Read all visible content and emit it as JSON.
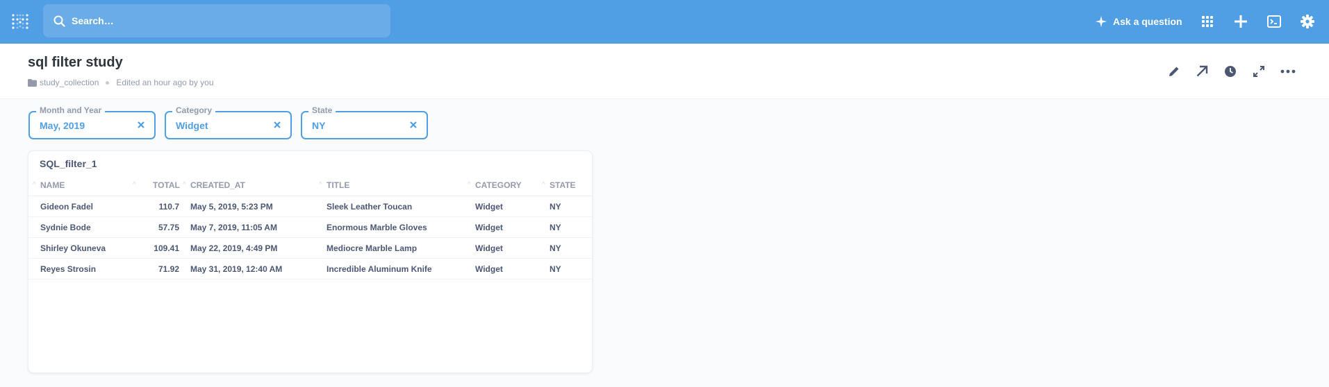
{
  "nav": {
    "search_placeholder": "Search…",
    "ask_label": "Ask a question"
  },
  "header": {
    "title": "sql filter study",
    "collection": "study_collection",
    "edited": "Edited an hour ago by you"
  },
  "filters": [
    {
      "label": "Month and Year",
      "value": "May, 2019"
    },
    {
      "label": "Category",
      "value": "Widget"
    },
    {
      "label": "State",
      "value": "NY"
    }
  ],
  "card": {
    "title": "SQL_filter_1",
    "columns": [
      "NAME",
      "TOTAL",
      "CREATED_AT",
      "TITLE",
      "CATEGORY",
      "STATE"
    ],
    "rows": [
      {
        "name": "Gideon Fadel",
        "total": "110.7",
        "created_at": "May 5, 2019, 5:23 PM",
        "title": "Sleek Leather Toucan",
        "category": "Widget",
        "state": "NY"
      },
      {
        "name": "Sydnie Bode",
        "total": "57.75",
        "created_at": "May 7, 2019, 11:05 AM",
        "title": "Enormous Marble Gloves",
        "category": "Widget",
        "state": "NY"
      },
      {
        "name": "Shirley Okuneva",
        "total": "109.41",
        "created_at": "May 22, 2019, 4:49 PM",
        "title": "Mediocre Marble Lamp",
        "category": "Widget",
        "state": "NY"
      },
      {
        "name": "Reyes Strosin",
        "total": "71.92",
        "created_at": "May 31, 2019, 12:40 AM",
        "title": "Incredible Aluminum Knife",
        "category": "Widget",
        "state": "NY"
      }
    ]
  },
  "colors": {
    "brand": "#509ee3",
    "text_dark": "#2e353b",
    "text_medium": "#4c5773",
    "text_light": "#949aab"
  }
}
